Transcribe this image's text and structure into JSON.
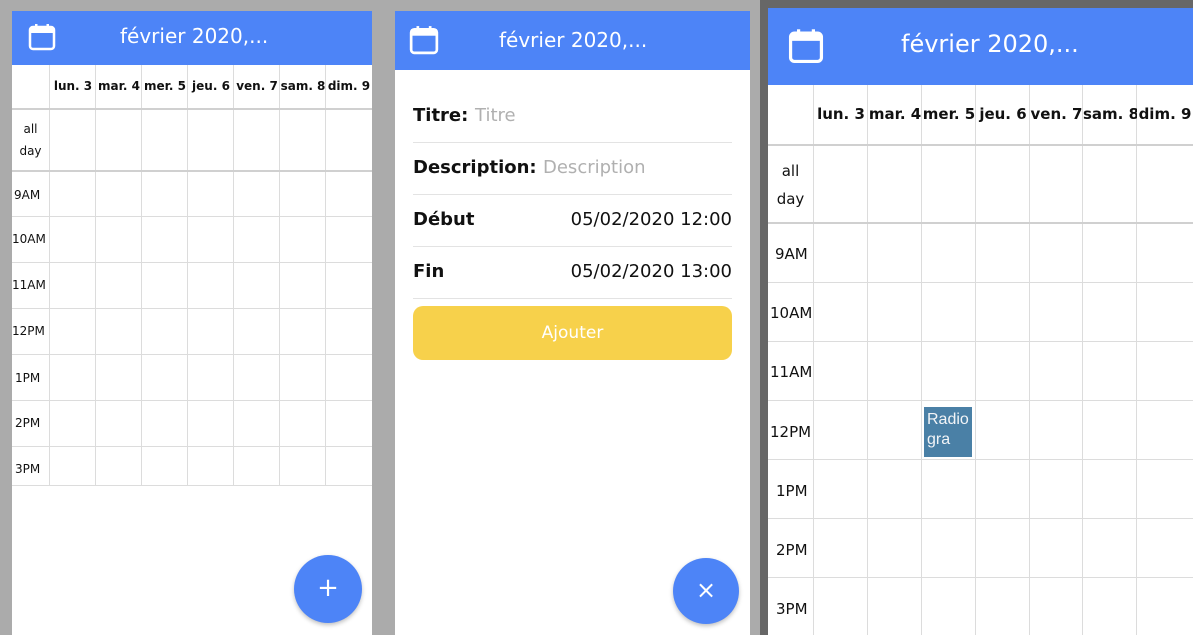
{
  "header": {
    "title": "février 2020,..."
  },
  "week": {
    "days": [
      "lun. 3",
      "mar. 4",
      "mer. 5",
      "jeu. 6",
      "ven. 7",
      "sam. 8",
      "dim. 9"
    ],
    "all_day": [
      "all",
      "day"
    ],
    "hours": [
      "9AM",
      "10AM",
      "11AM",
      "12PM",
      "1PM",
      "2PM",
      "3PM"
    ]
  },
  "form": {
    "title_label": "Titre:",
    "title_placeholder": "Titre",
    "description_label": "Description:",
    "description_placeholder": "Description",
    "start_label": "Début",
    "start_value": "05/02/2020 12:00",
    "end_label": "Fin",
    "end_value": "05/02/2020 13:00",
    "add_label": "Ajouter"
  },
  "event": {
    "title": "Radiogra"
  },
  "fab": {
    "add_symbol": "+",
    "close_symbol": "×"
  },
  "colors": {
    "primary": "#4d84f7",
    "accent": "#f7d14b",
    "event": "#4a80a6"
  },
  "icons": {
    "header": "calendar-icon"
  }
}
